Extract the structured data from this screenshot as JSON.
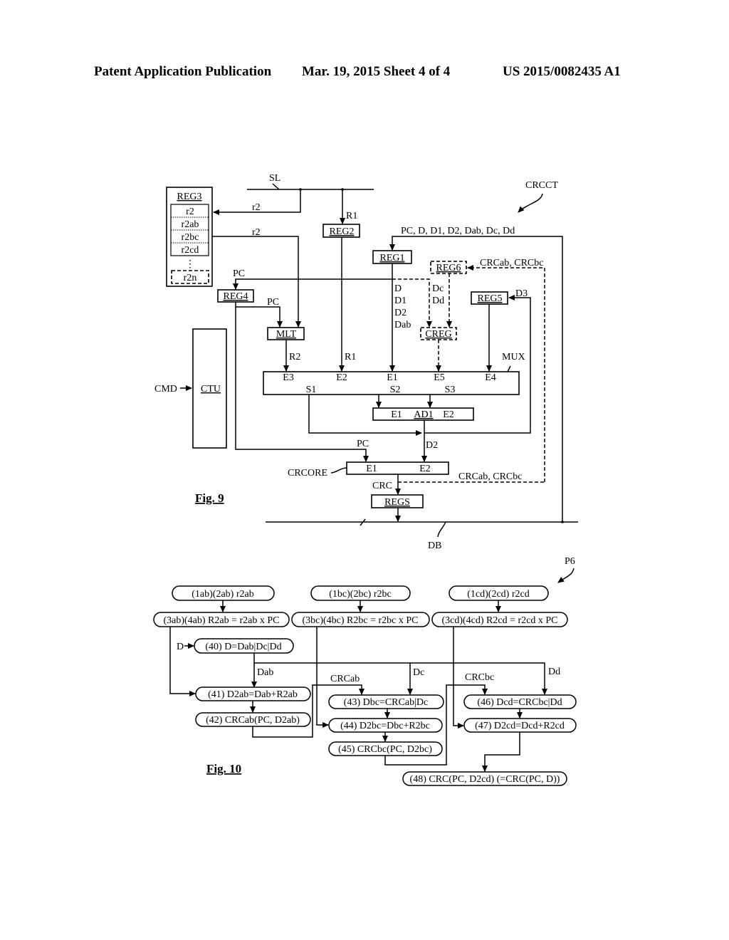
{
  "header": {
    "publication": "Patent Application Publication",
    "date_sheet": "Mar. 19, 2015  Sheet 4 of 4",
    "number": "US 2015/0082435 A1"
  },
  "fig9": {
    "caption": "Fig. 9",
    "ref_circuit": "CRCCT",
    "bus_sl": "SL",
    "bus_db": "DB",
    "reg3": {
      "title": "REG3",
      "slots": [
        "r2",
        "r2ab",
        "r2bc",
        "r2cd",
        "⋮",
        "r2n"
      ]
    },
    "reg1": "REG1",
    "reg2": "REG2",
    "reg4": "REG4",
    "reg5": "REG5",
    "reg6": "REG6",
    "creg": "CREG",
    "mlt": "MLT",
    "ctu": "CTU",
    "cmd": "CMD",
    "mux": "MUX",
    "ad1": "AD1",
    "regs": "REGS",
    "crcore": "CRCORE",
    "signals": {
      "r2_top": "r2",
      "r2_mid": "r2",
      "r1_top": "R1",
      "r1_bottom": "R1",
      "r2_out": "R2",
      "pc_reg4": "PC",
      "pc_mlt": "PC",
      "pc_crcore": "PC",
      "reg1_in": "PC, D, D1, D2, Dab, Dc, Dd",
      "reg1_out": [
        "D",
        "D1",
        "D2",
        "Dab"
      ],
      "reg6_out": [
        "Dc",
        "Dd"
      ],
      "reg6_in": "CRCab, CRCbc",
      "crc_feedback": "CRCab, CRCbc",
      "d3": "D3",
      "d2": "D2",
      "crc": "CRC"
    },
    "mux_inputs": [
      "E3",
      "E2",
      "E1",
      "E5",
      "E4"
    ],
    "mux_outputs": [
      "S1",
      "S2",
      "S3"
    ],
    "ad1_inputs": [
      "E1",
      "E2"
    ],
    "crcore_inputs": [
      "E1",
      "E2"
    ]
  },
  "fig10": {
    "caption": "Fig. 10",
    "ref_process": "P6",
    "steps": {
      "s1ab": "(1ab)(2ab) r2ab",
      "s1bc": "(1bc)(2bc) r2bc",
      "s1cd": "(1cd)(2cd) r2cd",
      "s3ab": "(3ab)(4ab) R2ab = r2ab x PC",
      "s3bc": "(3bc)(4bc) R2bc = r2bc x PC",
      "s3cd": "(3cd)(4cd) R2cd = r2cd x PC",
      "s40": "(40) D=Dab|Dc|Dd",
      "s41": "(41) D2ab=Dab+R2ab",
      "s42": "(42) CRCab(PC, D2ab)",
      "s43": "(43) Dbc=CRCab|Dc",
      "s44": "(44) D2bc=Dbc+R2bc",
      "s45": "(45) CRCbc(PC, D2bc)",
      "s46": "(46) Dcd=CRCbc|Dd",
      "s47": "(47) D2cd=Dcd+R2cd",
      "s48": "(48) CRC(PC, D2cd) (=CRC(PC, D))"
    },
    "labels": {
      "d_in": "D",
      "dab": "Dab",
      "dc": "Dc",
      "dd": "Dd",
      "crcab": "CRCab",
      "crcbc": "CRCbc"
    }
  }
}
